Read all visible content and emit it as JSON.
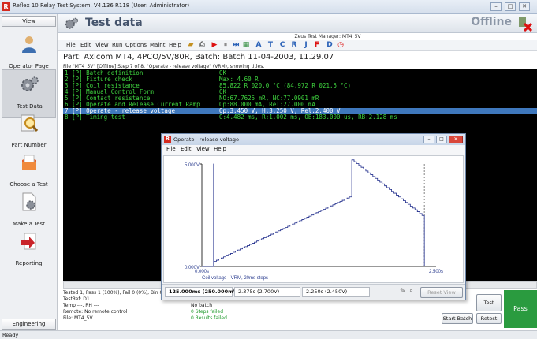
{
  "app": {
    "title": "Reflex 10 Relay Test System, V4.136 R118 (User: Administrator)",
    "icon": "app-logo-icon",
    "window_buttons": [
      "minimize",
      "restore",
      "close"
    ]
  },
  "sidebar": {
    "view_tab": "View",
    "items": [
      {
        "label": "Operator Page",
        "icon": "operator-icon"
      },
      {
        "label": "Test Data",
        "icon": "gears-icon",
        "active": true
      },
      {
        "label": "Part Number",
        "icon": "magnifier-icon"
      },
      {
        "label": "Choose a Test",
        "icon": "clipboard-icon"
      },
      {
        "label": "Make a Test",
        "icon": "document-gear-icon"
      },
      {
        "label": "Reporting",
        "icon": "report-icon"
      }
    ],
    "engineering_tab": "Engineering"
  },
  "header": {
    "title": "Test data",
    "status": "Offline"
  },
  "toolbar": {
    "manager_label": "Zeus Test Manager: MT4_5V",
    "menus": [
      "File",
      "Edit",
      "View",
      "Run",
      "Options",
      "Maint",
      "Help"
    ],
    "letters": [
      "A",
      "T",
      "C",
      "R",
      "J",
      "F",
      "D"
    ]
  },
  "part": {
    "label": "Part: Axicom MT4, 4PCO/5V/80R, Batch: Batch 11-04-2003, 11.29.07",
    "file_line": "File \"MT4_5V\" [Offline] Step 7 of 8, \"Operate - release voltage\" (VRM), showing titles."
  },
  "console": {
    "rows": [
      {
        "step": "1 [P] Batch definition",
        "value": "OK"
      },
      {
        "step": "2 [P] Fixture check",
        "value": "Max: 4.60 R"
      },
      {
        "step": "3 [P] Coil resistance",
        "value": "85.822 R 020.0 °C (84.972 R 021.5 °C)"
      },
      {
        "step": "4 [P] Manual Control Form",
        "value": "OK"
      },
      {
        "step": "5 [P] Contact resistance",
        "value": "NO:67.7625 mR, NC:77.0901 mR"
      },
      {
        "step": "6 [P] Operate and Release Current Ramp",
        "value": "Op:88.000 mA, Rel:27.000 mA"
      },
      {
        "step": "7 [P] Operate - release voltage",
        "value": "Op:3.450 V, H:3.250 V, Rel:2.400 V",
        "selected": true
      },
      {
        "step": "8 [P] Timing test",
        "value": "O:4.482 ms, R:1.002 ms, OB:183.000 us, RB:2.128 ms"
      }
    ]
  },
  "status": {
    "left": [
      "Tested 1, Pass 1 (100%), Fail 0 (0%), Bin 0",
      "TestRef: D1",
      "Temp ---, RH ---",
      "Remote: No remote control",
      "File: MT4_5V"
    ],
    "right": [
      "No batch",
      "0 Steps failed",
      "0 Results failed"
    ],
    "test_button": "Test",
    "start_batch_button": "Start Batch",
    "retest_button": "Retest",
    "pass_label": "Pass"
  },
  "statusbar": {
    "text": "Ready"
  },
  "popup": {
    "title": "Operate - release voltage",
    "menus": [
      "File",
      "Edit",
      "View",
      "Help"
    ],
    "readouts": [
      "125.000ms (250.000mV)",
      "2.375s (2.700V)",
      "2.250s (2.450V)"
    ],
    "reset_button": "Reset View",
    "tool_icons": [
      "pen-icon",
      "magnifier-icon"
    ]
  },
  "chart_data": {
    "type": "line",
    "title": "",
    "xlabel": "Coil voltage - VRM, 20ms steps",
    "ylabel": "",
    "x_ticks": [
      "0.000s",
      "2.500s"
    ],
    "y_ticks": [
      "0.000V",
      "5.000V"
    ],
    "xlim": [
      0,
      2.5
    ],
    "ylim": [
      0,
      5
    ],
    "series": [
      {
        "x": [
          0,
          0.125,
          0.125,
          0.13,
          0.13,
          1.6,
          1.6,
          2.375,
          2.375
        ],
        "y": [
          0,
          0,
          5.0,
          5.0,
          0.25,
          3.45,
          5.2,
          2.4,
          0
        ]
      }
    ],
    "markers": [
      2.375
    ]
  }
}
